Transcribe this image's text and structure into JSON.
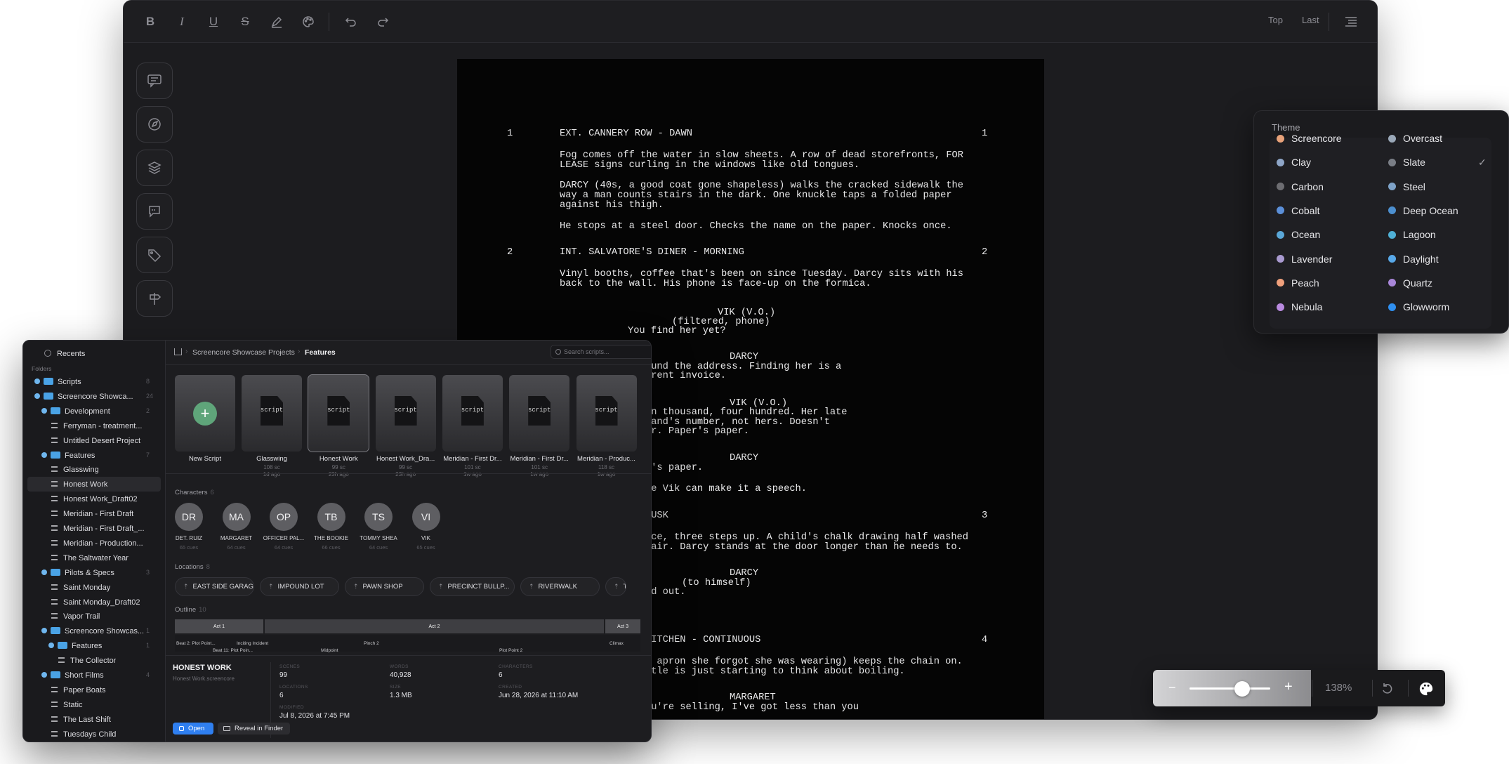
{
  "toolbar": {
    "top": "Top",
    "last": "Last"
  },
  "script": {
    "scenes": [
      {
        "num": "1",
        "heading": "EXT. CANNERY ROW - DAWN"
      },
      {
        "num": "2",
        "heading": "INT. SALVATORE'S DINER - MORNING"
      },
      {
        "num": "3",
        "heading": "DUSK"
      },
      {
        "num": "4",
        "heading": "KITCHEN - CONTINUOUS"
      }
    ],
    "lines": [
      "Fog comes off the water in slow sheets. A row of dead storefronts, FOR",
      "LEASE signs curling in the windows like old tongues.",
      "DARCY (40s, a good coat gone shapeless) walks the cracked sidewalk the",
      "way a man counts stairs in the dark. One knuckle taps a folded paper",
      "against his thigh.",
      "He stops at a steel door. Checks the name on the paper. Knocks once.",
      "Vinyl booths, coffee that's been on since Tuesday. Darcy sits with his",
      "back to the wall. His phone is face-up on the formica.",
      "VIK (V.O.)",
      "(filtered, phone)",
      "You find her yet?",
      "DARCY",
      "ound the address. Finding her is a",
      "erent invoice.",
      "VIK (V.O.)",
      "en thousand, four hundred. Her late",
      "band's number, not hers. Doesn't",
      "er. Paper's paper.",
      "DARCY",
      "r's paper.",
      "re Vik can make it a speech.",
      "ace, three steps up. A child's chalk drawing half washed",
      "tair. Darcy stands at the door longer than he needs to.",
      "DARCY",
      "(to himself)",
      "nd out.",
      "n apron she forgot she was wearing) keeps the chain on.",
      "ttle is just starting to think about boiling.",
      "MARGARET",
      "ou're selling, I've got less than you"
    ]
  },
  "theme": {
    "title": "Theme",
    "left": [
      {
        "name": "Screencore",
        "color": "#e8a27a"
      },
      {
        "name": "Clay",
        "color": "#8fa6c8"
      },
      {
        "name": "Carbon",
        "color": "#6d6d72"
      },
      {
        "name": "Cobalt",
        "color": "#5b8fd8"
      },
      {
        "name": "Ocean",
        "color": "#5aa7d8"
      },
      {
        "name": "Lavender",
        "color": "#a99ad0"
      },
      {
        "name": "Peach",
        "color": "#f0a07c"
      },
      {
        "name": "Nebula",
        "color": "#b98ae0"
      }
    ],
    "right": [
      {
        "name": "Overcast",
        "color": "#9aa8b8"
      },
      {
        "name": "Slate",
        "color": "#7a7e86"
      },
      {
        "name": "Steel",
        "color": "#7ea2c8"
      },
      {
        "name": "Deep Ocean",
        "color": "#4c8fcf"
      },
      {
        "name": "Lagoon",
        "color": "#4fb0d6"
      },
      {
        "name": "Daylight",
        "color": "#58a8e8"
      },
      {
        "name": "Quartz",
        "color": "#a886d8"
      },
      {
        "name": "Glowworm",
        "color": "#2f8ff0"
      }
    ],
    "selected": "Slate"
  },
  "zoom": {
    "value": "138%",
    "level": 0.65
  },
  "browser": {
    "recents": "Recents",
    "folders_label": "Folders",
    "tree": [
      {
        "label": "Scripts",
        "type": "folder",
        "indent": 0,
        "count": "8"
      },
      {
        "label": "Screencore Showca...",
        "type": "folder",
        "indent": 0,
        "count": "24"
      },
      {
        "label": "Development",
        "type": "folder",
        "indent": 1,
        "count": "2"
      },
      {
        "label": "Ferryman - treatment...",
        "type": "doc",
        "indent": 2,
        "count": ""
      },
      {
        "label": "Untitled Desert Project",
        "type": "doc",
        "indent": 2,
        "count": ""
      },
      {
        "label": "Features",
        "type": "folder",
        "indent": 1,
        "count": "7"
      },
      {
        "label": "Glasswing",
        "type": "doc",
        "indent": 2,
        "count": ""
      },
      {
        "label": "Honest Work",
        "type": "doc",
        "indent": 2,
        "count": ""
      },
      {
        "label": "Honest Work_Draft02",
        "type": "doc",
        "indent": 2,
        "count": ""
      },
      {
        "label": "Meridian - First Draft",
        "type": "doc",
        "indent": 2,
        "count": ""
      },
      {
        "label": "Meridian - First Draft_...",
        "type": "doc",
        "indent": 2,
        "count": ""
      },
      {
        "label": "Meridian - Production...",
        "type": "doc",
        "indent": 2,
        "count": ""
      },
      {
        "label": "The Saltwater Year",
        "type": "doc",
        "indent": 2,
        "count": ""
      },
      {
        "label": "Pilots & Specs",
        "type": "folder",
        "indent": 1,
        "count": "3"
      },
      {
        "label": "Saint Monday",
        "type": "doc",
        "indent": 2,
        "count": ""
      },
      {
        "label": "Saint Monday_Draft02",
        "type": "doc",
        "indent": 2,
        "count": ""
      },
      {
        "label": "Vapor Trail",
        "type": "doc",
        "indent": 2,
        "count": ""
      },
      {
        "label": "Screencore Showcas...",
        "type": "folder",
        "indent": 1,
        "count": "1"
      },
      {
        "label": "Features",
        "type": "folder",
        "indent": 2,
        "count": "1"
      },
      {
        "label": "The Collector",
        "type": "doc",
        "indent": 3,
        "count": ""
      },
      {
        "label": "Short Films",
        "type": "folder",
        "indent": 1,
        "count": "4"
      },
      {
        "label": "Paper Boats",
        "type": "doc",
        "indent": 2,
        "count": ""
      },
      {
        "label": "Static",
        "type": "doc",
        "indent": 2,
        "count": ""
      },
      {
        "label": "The Last Shift",
        "type": "doc",
        "indent": 2,
        "count": ""
      },
      {
        "label": "Tuesdays Child",
        "type": "doc",
        "indent": 2,
        "count": ""
      }
    ],
    "breadcrumb": [
      "Screencore Showcase Projects",
      "Features"
    ],
    "search_placeholder": "Search scripts...",
    "new_script": "New Script",
    "cards": [
      {
        "title": "Glasswing",
        "meta": "108 sc",
        "date": "1d ago"
      },
      {
        "title": "Honest Work",
        "meta": "99 sc",
        "date": "23h ago"
      },
      {
        "title": "Honest Work_Dra...",
        "meta": "99 sc",
        "date": "23h ago"
      },
      {
        "title": "Meridian - First Dr...",
        "meta": "101 sc",
        "date": "1w ago"
      },
      {
        "title": "Meridian - First Dr...",
        "meta": "101 sc",
        "date": "1w ago"
      },
      {
        "title": "Meridian - Produc...",
        "meta": "118 sc",
        "date": "1w ago"
      }
    ],
    "card_icon_text": "script",
    "characters_label": "Characters",
    "characters_count": "6",
    "characters": [
      {
        "initials": "DR",
        "name": "DET. RUIZ",
        "cues": "65 cues"
      },
      {
        "initials": "MA",
        "name": "MARGARET",
        "cues": "64 cues"
      },
      {
        "initials": "OP",
        "name": "OFFICER PAL...",
        "cues": "64 cues"
      },
      {
        "initials": "TB",
        "name": "THE BOOKIE",
        "cues": "66 cues"
      },
      {
        "initials": "TS",
        "name": "TOMMY SHEA",
        "cues": "64 cues"
      },
      {
        "initials": "VI",
        "name": "VIK",
        "cues": "65 cues"
      }
    ],
    "locations_label": "Locations",
    "locations_count": "8",
    "locations": [
      "EAST SIDE GARAGE",
      "IMPOUND LOT",
      "PAWN SHOP",
      "PRECINCT BULLP...",
      "RIVERWALK",
      "T"
    ],
    "outline_label": "Outline",
    "outline_count": "10",
    "acts": [
      "Act 1",
      "Act 2",
      "Act 3"
    ],
    "beats": [
      "Beat 2: Plot Point...",
      "Inciting Incident",
      "Beat 11: Plot Poin...",
      "Pinch 2",
      "Midpoint",
      "Plot Point 2",
      "Climax"
    ],
    "detail": {
      "title": "HONEST WORK",
      "file": "Honest Work.screencore",
      "scenes_label": "SCENES",
      "scenes": "99",
      "words_label": "WORDS",
      "words": "40,928",
      "characters_label": "CHARACTERS",
      "characters": "6",
      "locations_label": "LOCATIONS",
      "locations": "6",
      "size_label": "SIZE",
      "size": "1.3 MB",
      "created_label": "CREATED",
      "created": "Jun 28, 2026 at 11:10 AM",
      "modified_label": "MODIFIED",
      "modified": "Jul 8, 2026 at 7:45 PM"
    },
    "open": "Open",
    "reveal": "Reveal in Finder"
  }
}
